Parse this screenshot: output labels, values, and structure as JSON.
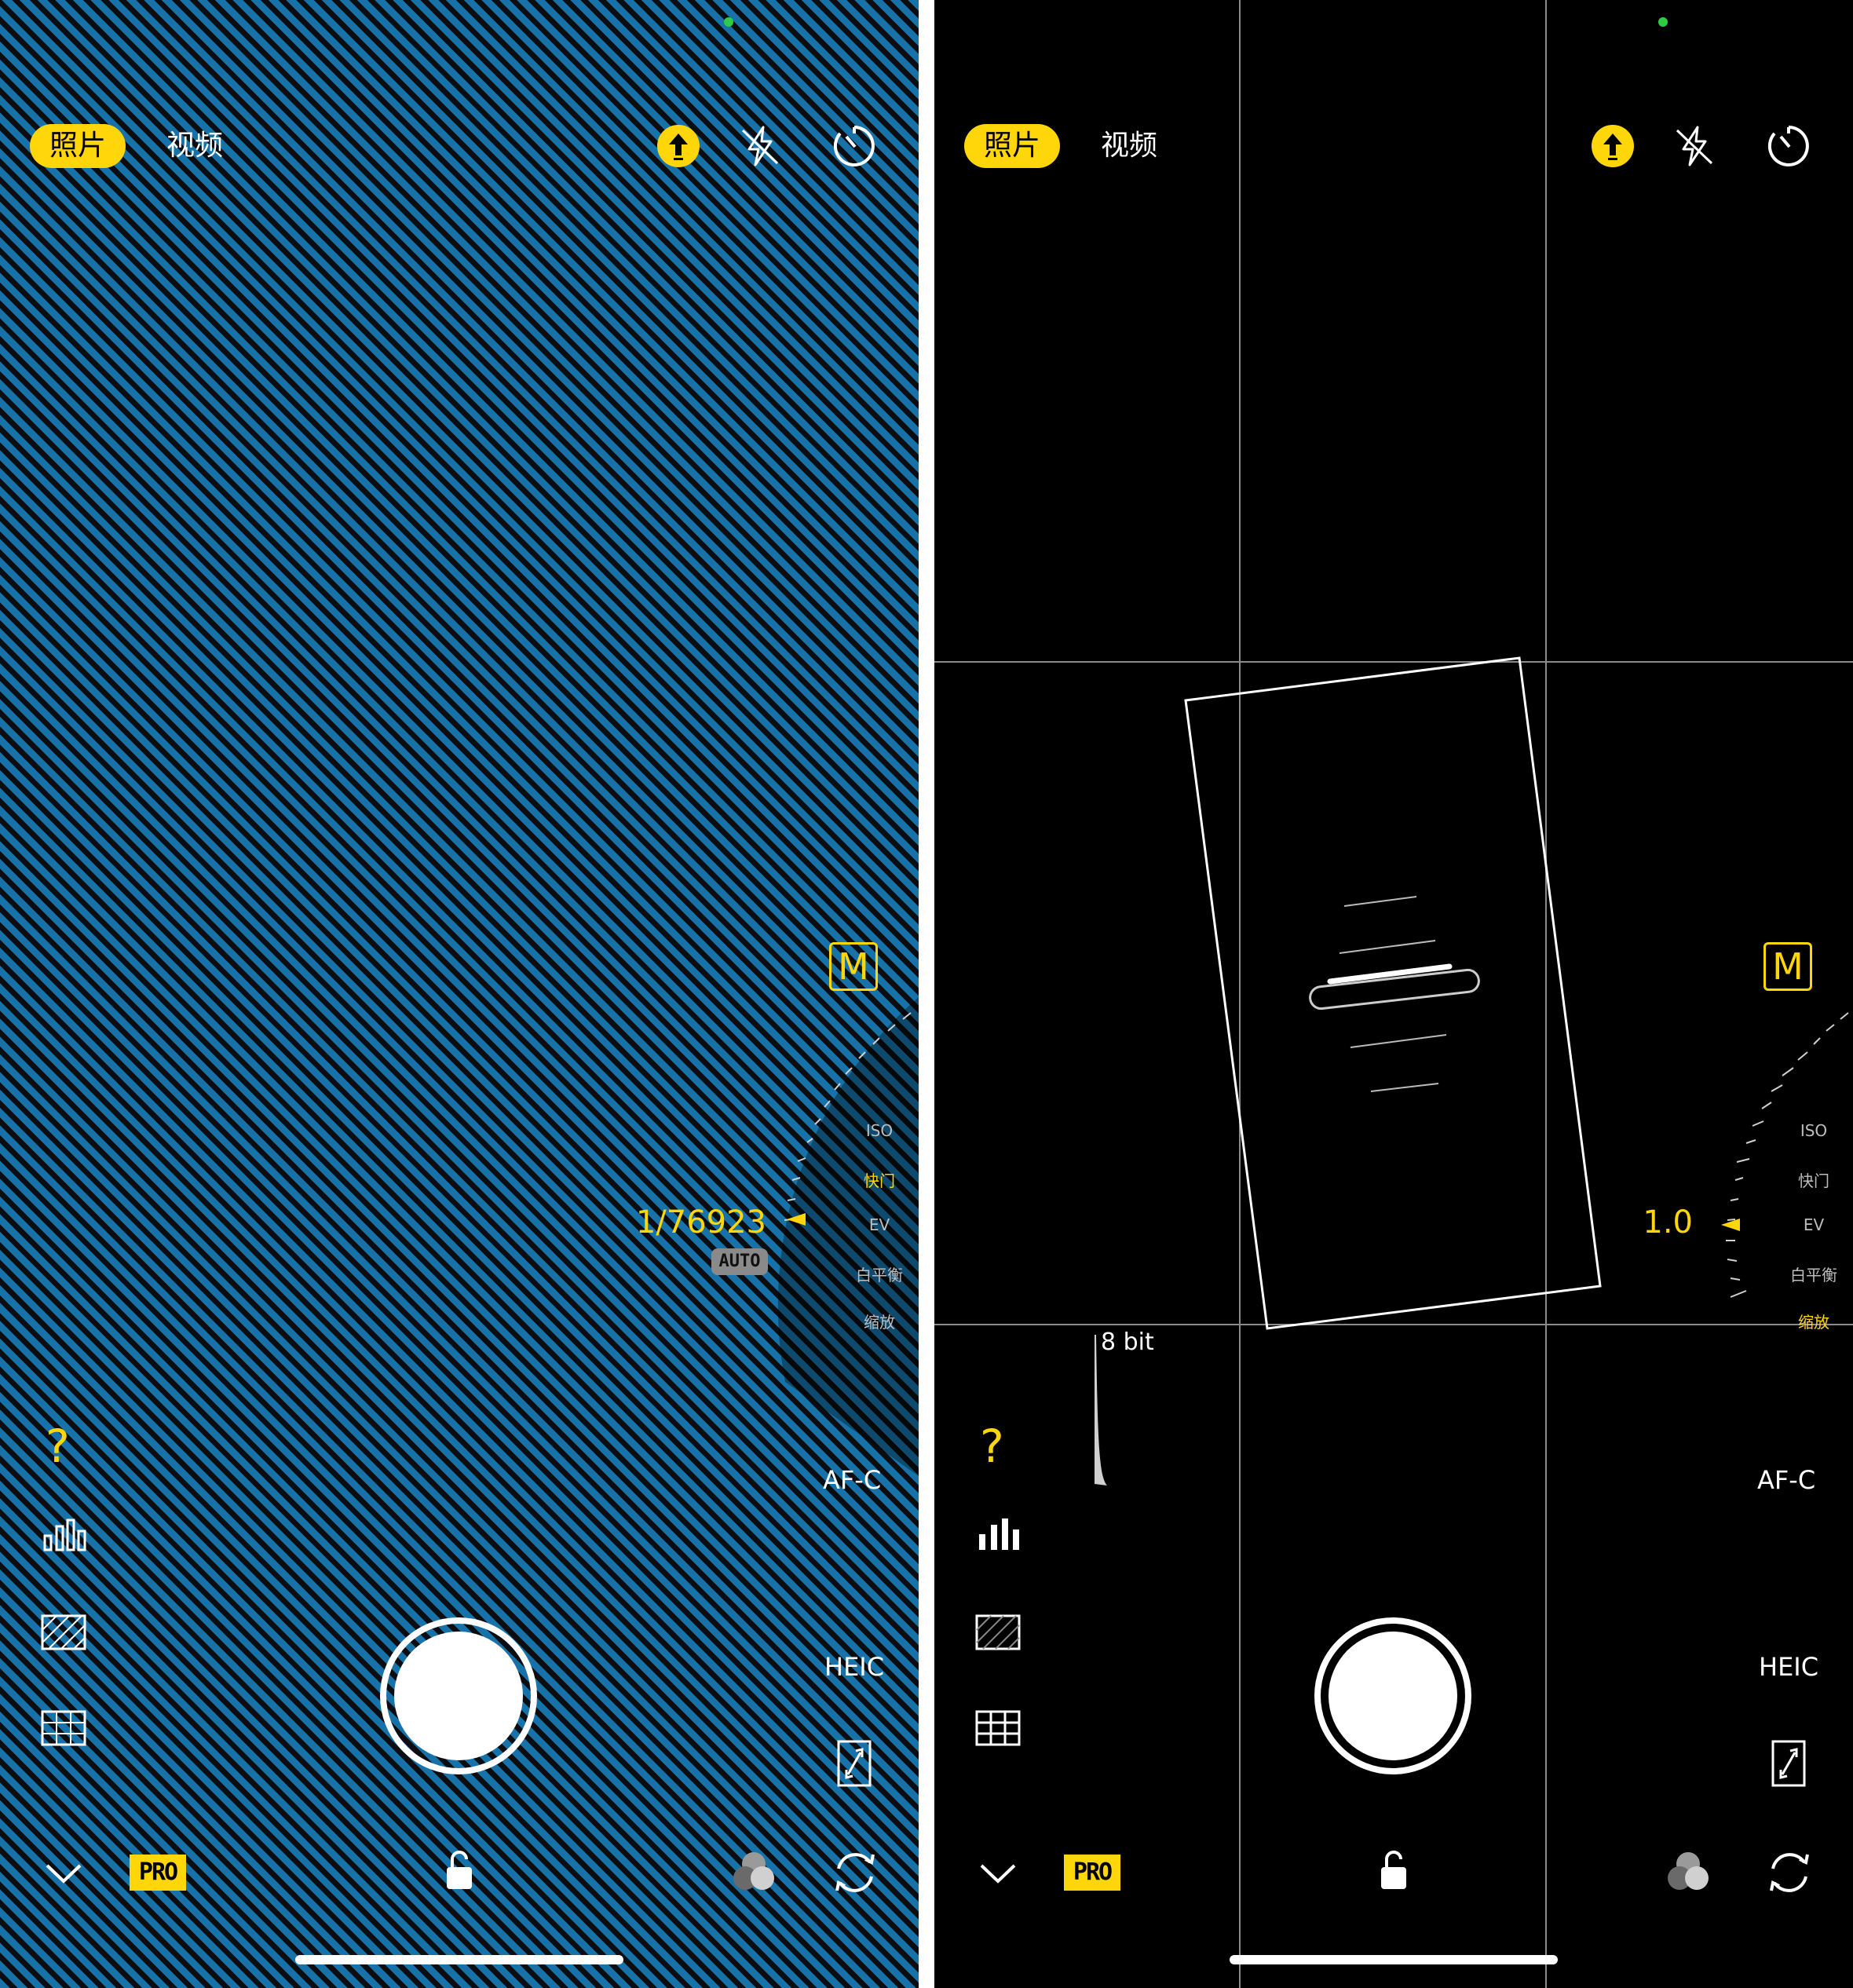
{
  "left": {
    "mode_tabs": {
      "photo": "照片",
      "video": "视频"
    },
    "manual_badge": "M",
    "params": {
      "iso": "ISO",
      "shutter": "快门",
      "ev": "EV",
      "wb": "白平衡",
      "zoom": "缩放"
    },
    "selected_param": "快门",
    "value": "1/76923",
    "auto_label": "AUTO",
    "focus_mode": "AF-C",
    "format": "HEIC",
    "help": "?",
    "pro_label": "PRO"
  },
  "right": {
    "mode_tabs": {
      "photo": "照片",
      "video": "视频"
    },
    "manual_badge": "M",
    "params": {
      "iso": "ISO",
      "shutter": "快门",
      "ev": "EV",
      "wb": "白平衡",
      "zoom": "缩放"
    },
    "selected_param": "缩放",
    "value": "1.0",
    "bit_depth": "8 bit",
    "focus_mode": "AF-C",
    "format": "HEIC",
    "help": "?",
    "pro_label": "PRO"
  },
  "colors": {
    "accent": "#FFD60A",
    "stripe": "#1672a8",
    "background": "#000000"
  },
  "icons": [
    "upload-icon",
    "flash-off-icon",
    "timer-icon",
    "help-icon",
    "histogram-icon",
    "zebra-icon",
    "grid-icon",
    "aspect-icon",
    "chevron-down-icon",
    "lock-icon",
    "filters-icon",
    "flip-camera-icon"
  ]
}
